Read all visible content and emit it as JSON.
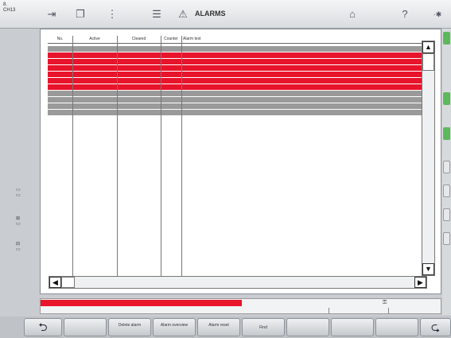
{
  "topbar": {
    "indicator": "8.\nCH13",
    "title": "ALARMS",
    "icons": [
      "exit-icon",
      "copy-icon",
      "info-icon",
      "stack-icon",
      "warning-icon",
      "home-icon",
      "help-icon",
      "settings-icon"
    ]
  },
  "table": {
    "columns": [
      "No.",
      "Active",
      "Cleared",
      "Counter",
      "Alarm text"
    ],
    "rows": [
      {
        "type": "grey",
        "no": "",
        "active": "",
        "cleared": "",
        "counter": "",
        "text": ""
      },
      {
        "type": "red",
        "no": "",
        "active": "",
        "cleared": "",
        "counter": "",
        "text": ""
      },
      {
        "type": "red",
        "no": "",
        "active": "",
        "cleared": "",
        "counter": "",
        "text": ""
      },
      {
        "type": "red",
        "no": "",
        "active": "",
        "cleared": "",
        "counter": "",
        "text": ""
      },
      {
        "type": "red",
        "no": "",
        "active": "",
        "cleared": "",
        "counter": "",
        "text": ""
      },
      {
        "type": "red",
        "no": "",
        "active": "",
        "cleared": "",
        "counter": "",
        "text": ""
      },
      {
        "type": "red",
        "no": "",
        "active": "",
        "cleared": "",
        "counter": "",
        "text": ""
      },
      {
        "type": "grey",
        "no": "",
        "active": "",
        "cleared": "",
        "counter": "",
        "text": ""
      },
      {
        "type": "grey",
        "no": "",
        "active": "",
        "cleared": "",
        "counter": "",
        "text": ""
      },
      {
        "type": "grey",
        "no": "",
        "active": "",
        "cleared": "",
        "counter": "",
        "text": ""
      },
      {
        "type": "grey",
        "no": "",
        "active": "",
        "cleared": "",
        "counter": "",
        "text": ""
      }
    ]
  },
  "status": {
    "message": "",
    "field1": "",
    "field2": "",
    "field3": ""
  },
  "softkeys": [
    {
      "label": "",
      "icon": "back-arrow-icon"
    },
    {
      "label": ""
    },
    {
      "label": "Delete alarm"
    },
    {
      "label": "Alarm overview"
    },
    {
      "label": "Alarm reset"
    },
    {
      "label": "Find"
    },
    {
      "label": ""
    },
    {
      "label": ""
    },
    {
      "label": ""
    },
    {
      "label": "",
      "icon": "forward-arrow-icon"
    }
  ],
  "colors": {
    "alarm_active": "#e8142c",
    "alarm_cleared": "#9a9a9a"
  }
}
